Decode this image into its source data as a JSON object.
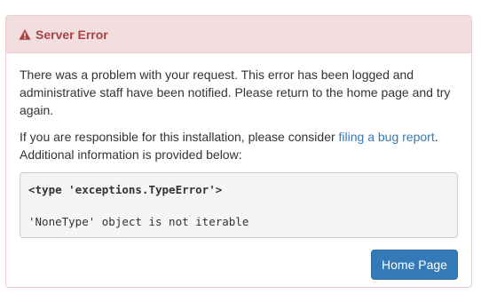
{
  "panel": {
    "title": "Server Error",
    "icon": "warning-triangle-icon",
    "accent_color": "#a94442",
    "heading_bg": "#f2dede"
  },
  "message": {
    "paragraph1": "There was a problem with your request. This error has been logged and administrative staff have been notified. Please return to the home page and try again.",
    "paragraph2_before": "If you are responsible for this installation, please consider ",
    "paragraph2_link": "filing a bug report",
    "paragraph2_after": ". Additional information is provided below:"
  },
  "error": {
    "type_line": "<type 'exceptions.TypeError'>",
    "message_line": "'NoneType' object is not iterable"
  },
  "actions": {
    "home_label": "Home Page",
    "home_color": "#337ab7"
  }
}
